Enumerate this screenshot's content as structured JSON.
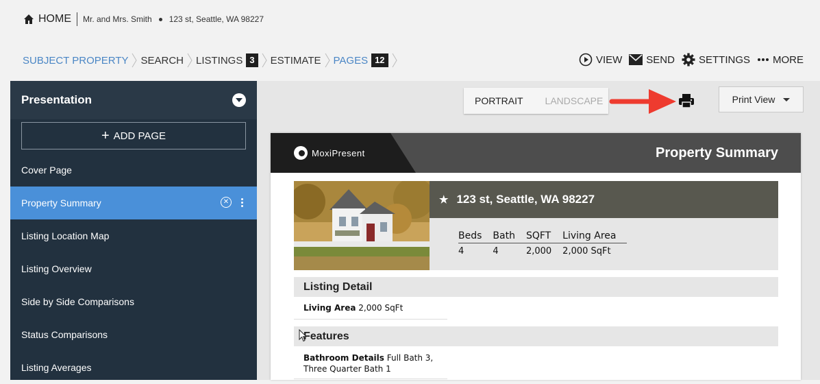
{
  "header": {
    "home_label": "HOME",
    "client": "Mr. and Mrs. Smith",
    "address": "123 st, Seattle, WA 98227"
  },
  "breadcrumbs": [
    {
      "label": "SUBJECT PROPERTY",
      "active": true
    },
    {
      "label": "SEARCH"
    },
    {
      "label": "LISTINGS",
      "badge": "3"
    },
    {
      "label": "ESTIMATE"
    },
    {
      "label": "PAGES",
      "badge": "12",
      "active": true
    }
  ],
  "actions": {
    "view": "VIEW",
    "send": "SEND",
    "settings": "SETTINGS",
    "more": "MORE"
  },
  "sidebar": {
    "title": "Presentation",
    "add_page": "ADD PAGE",
    "items": [
      {
        "label": "Cover Page"
      },
      {
        "label": "Property Summary",
        "active": true
      },
      {
        "label": "Listing Location Map"
      },
      {
        "label": "Listing Overview"
      },
      {
        "label": "Side by Side Comparisons"
      },
      {
        "label": "Status Comparisons"
      },
      {
        "label": "Listing Averages"
      }
    ]
  },
  "toolbar": {
    "portrait": "PORTRAIT",
    "landscape": "LANDSCAPE",
    "print_view": "Print View",
    "print_icon": "printer-icon",
    "annotation_color": "#ee3b2f"
  },
  "page": {
    "brand": "MoxiPresent",
    "title": "Property Summary",
    "address": "123 st, Seattle, WA 98227",
    "stats_headers": [
      "Beds",
      "Bath",
      "SQFT",
      "Living Area"
    ],
    "stats_values": [
      "4",
      "4",
      "2,000",
      "2,000 SqFt"
    ],
    "listing_detail_title": "Listing Detail",
    "living_area_label": "Living Area",
    "living_area_value": "2,000 SqFt",
    "features_title": "Features",
    "bathroom_label": "Bathroom Details",
    "bathroom_value_1": "Full Bath 3,",
    "bathroom_value_2": "Three Quarter Bath 1"
  },
  "colors": {
    "accent": "#4a86c5",
    "sidebar_bg": "#22313f",
    "sidebar_active": "#4a90d9",
    "hero_band": "#58584f"
  }
}
